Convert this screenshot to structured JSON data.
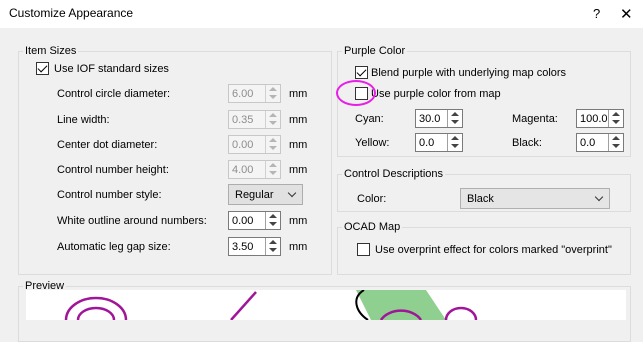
{
  "window": {
    "title": "Customize Appearance",
    "help": "?",
    "close": "✕"
  },
  "item_sizes": {
    "legend": "Item Sizes",
    "use_iof": {
      "label": "Use IOF standard sizes",
      "checked": true
    },
    "rows": [
      {
        "label": "Control circle diameter:",
        "value": "6.00",
        "unit": "mm",
        "enabled": false
      },
      {
        "label": "Line width:",
        "value": "0.35",
        "unit": "mm",
        "enabled": false
      },
      {
        "label": "Center dot diameter:",
        "value": "0.00",
        "unit": "mm",
        "enabled": false
      },
      {
        "label": "Control number height:",
        "value": "4.00",
        "unit": "mm",
        "enabled": false
      }
    ],
    "style": {
      "label": "Control number style:",
      "value": "Regular"
    },
    "white_outline": {
      "label": "White outline around numbers:",
      "value": "0.00",
      "unit": "mm"
    },
    "leg_gap": {
      "label": "Automatic leg gap size:",
      "value": "3.50",
      "unit": "mm"
    }
  },
  "purple_color": {
    "legend": "Purple Color",
    "blend": {
      "label": "Blend purple with underlying map colors",
      "checked": true
    },
    "use_from_map": {
      "label": "Use purple color from map",
      "checked": false
    },
    "cyan": {
      "label": "Cyan:",
      "value": "30.0"
    },
    "magenta": {
      "label": "Magenta:",
      "value": "100.0"
    },
    "yellow": {
      "label": "Yellow:",
      "value": "0.0"
    },
    "black": {
      "label": "Black:",
      "value": "0.0"
    }
  },
  "control_descriptions": {
    "legend": "Control Descriptions",
    "color": {
      "label": "Color:",
      "value": "Black"
    }
  },
  "ocad_map": {
    "legend": "OCAD Map",
    "overprint": {
      "label": "Use overprint effect for colors marked \"overprint\"",
      "checked": false
    }
  },
  "preview": {
    "legend": "Preview"
  },
  "colors": {
    "purple": "#a0159a",
    "green": "#8fcf8f",
    "highlight": "#e81ee8"
  }
}
